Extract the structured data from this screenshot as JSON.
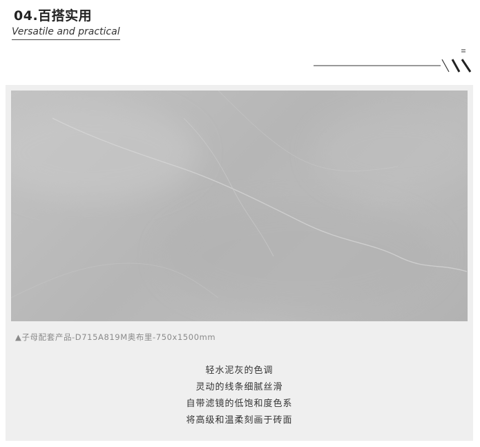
{
  "header": {
    "title": "04.百搭实用",
    "subtitle": "Versatile and practical"
  },
  "product": {
    "caption": "▲子母配套产品-D715A819M奥布里-750x1500mm",
    "description_lines": [
      "轻水泥灰的色调",
      "灵动的线条细腻丝滑",
      "自带滤镜的低饱和度色系",
      "将高级和温柔刻画于砖面"
    ]
  },
  "colors": {
    "tile": "#bcbcbc",
    "panel": "#efefef",
    "text": "#333333",
    "caption": "#8a8a8a"
  }
}
